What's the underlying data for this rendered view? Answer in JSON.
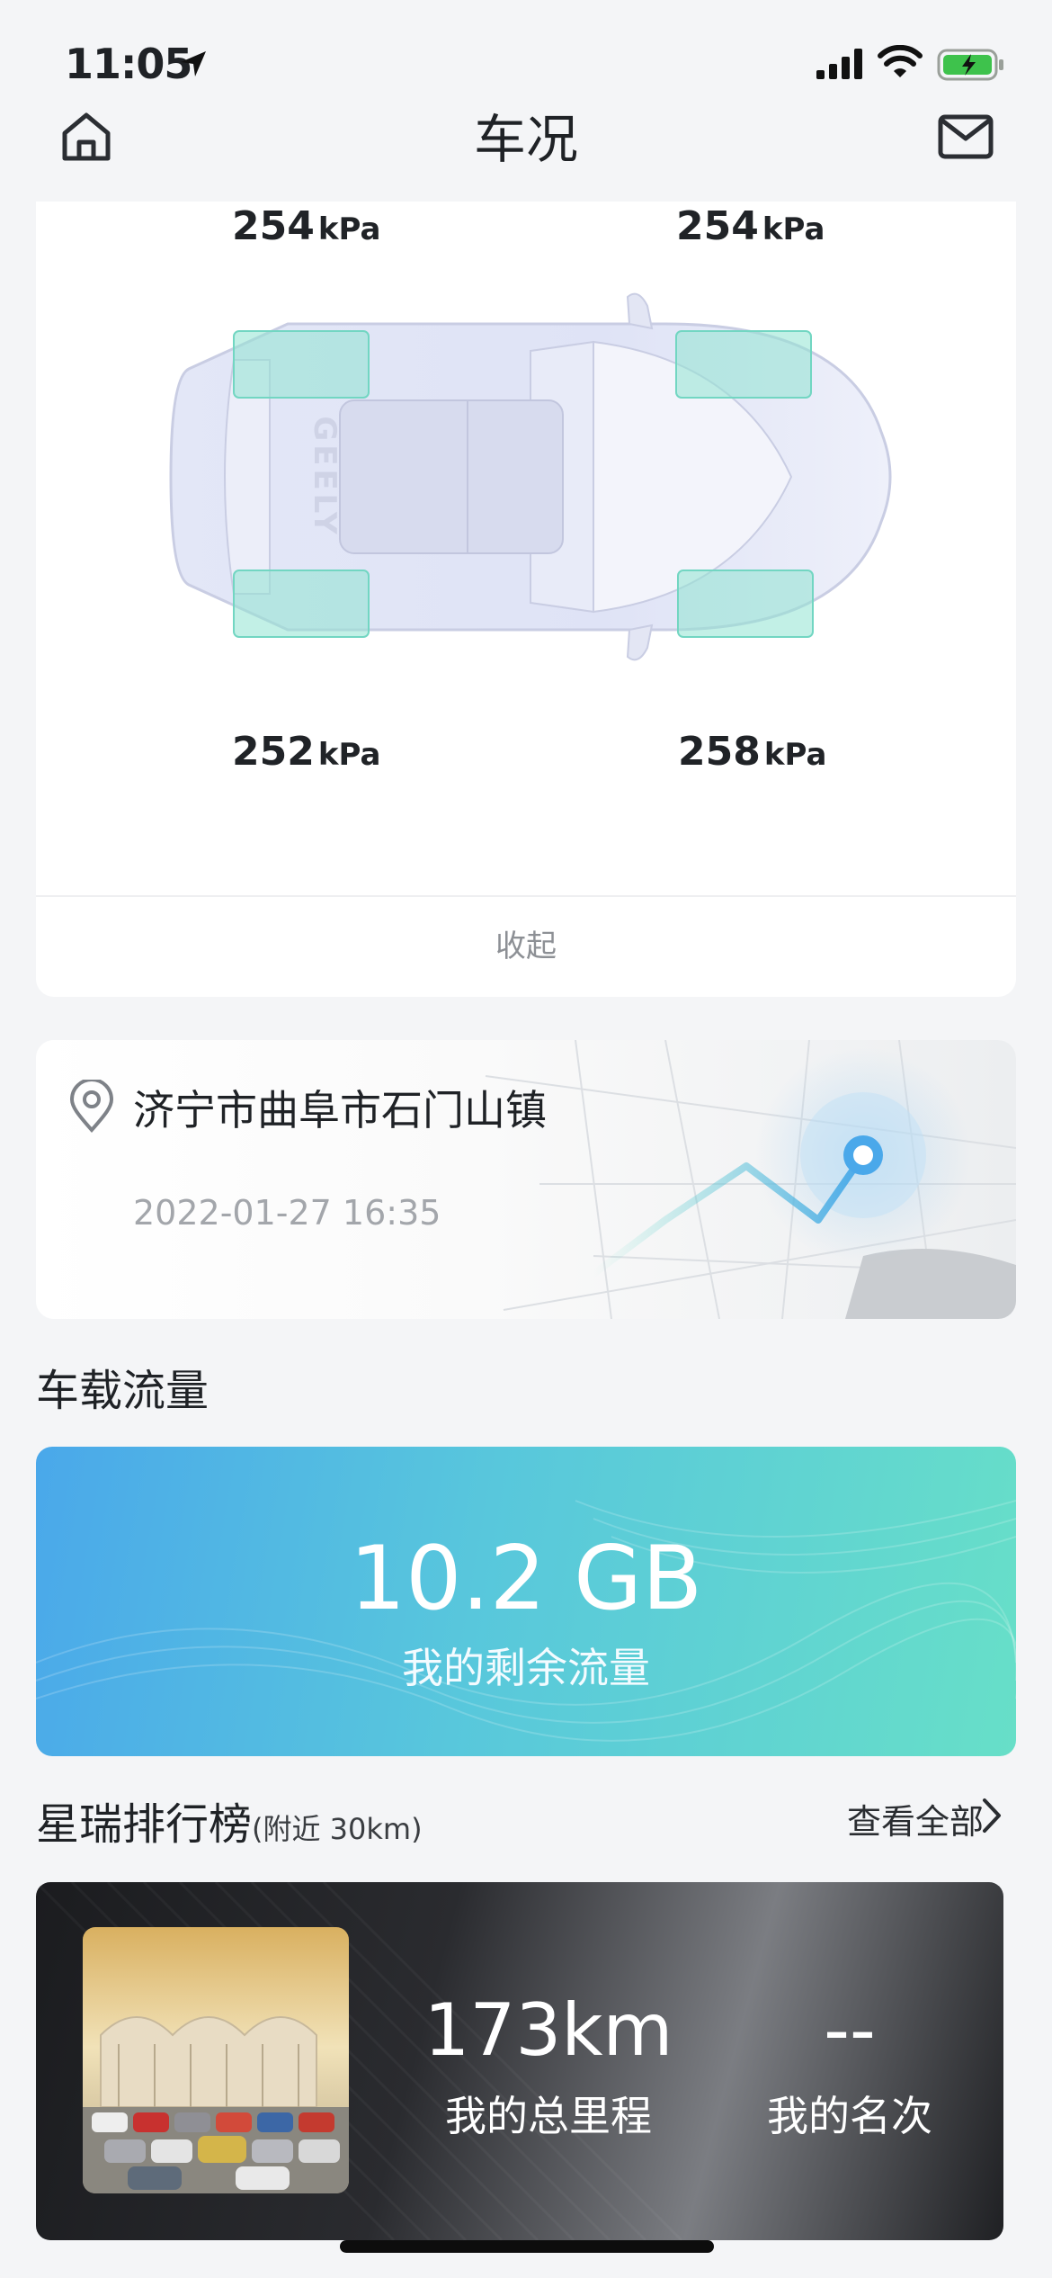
{
  "status": {
    "time": "11:05"
  },
  "header": {
    "title": "车况"
  },
  "tires": {
    "front_left": "254",
    "front_right": "254",
    "rear_left": "252",
    "rear_right": "258",
    "unit": "kPa",
    "collapse_label": "收起"
  },
  "location": {
    "address": "济宁市曲阜市石门山镇",
    "datetime": "2022-01-27 16:35"
  },
  "data_usage": {
    "section_title": "车载流量",
    "value": "10.2 GB",
    "label": "我的剩余流量"
  },
  "ranking": {
    "section_title": "星瑞排行榜",
    "section_subtitle": "(附近 30km)",
    "view_all": "查看全部",
    "total_mileage": "173km",
    "total_mileage_label": "我的总里程",
    "rank": "--",
    "rank_label": "我的名次"
  },
  "icons": {
    "home": "home-icon",
    "mail": "mail-icon",
    "pin": "location-pin-icon",
    "chevron": "chevron-right-icon"
  },
  "colors": {
    "accent_teal": "#67dfc8",
    "accent_blue": "#4aa8ea",
    "background": "#f4f5f7"
  }
}
